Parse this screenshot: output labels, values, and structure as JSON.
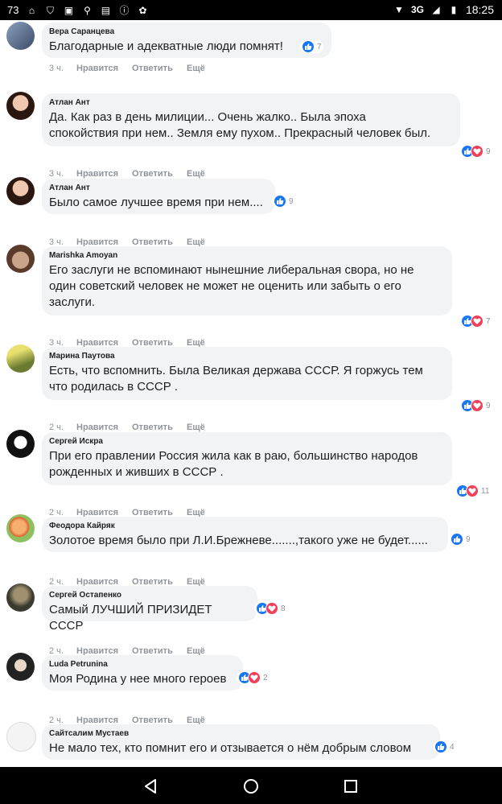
{
  "status_bar": {
    "left_text": "73",
    "network": "3G",
    "time": "18:25"
  },
  "actions": {
    "like": "Нравится",
    "reply": "Ответить",
    "more": "Ещё"
  },
  "comments": [
    {
      "author": "Вера Саранцева",
      "text": [
        "Благодарные и адекватные люди помнят!"
      ],
      "time": "3 ч.",
      "reactions": [
        "like"
      ],
      "count": "7"
    },
    {
      "author": "Атлан Ант",
      "text": [
        "Да. Как раз в день милиции... Очень жалко.. Была эпоха",
        "спокойствия при нем.. Земля ему пухом.. Прекрасный человек был."
      ],
      "time": "3 ч.",
      "reactions": [
        "like",
        "love"
      ],
      "count": "9"
    },
    {
      "author": "Атлан Ант",
      "text": [
        "Было самое лучшее время при нем...."
      ],
      "time": "3 ч.",
      "reactions": [
        "like"
      ],
      "count": "9"
    },
    {
      "author": "Marishka Amoyan",
      "text": [
        "Его заслуги не вспоминают нынешние либеральная свора, но не",
        "один советский человек не может не оценить или забыть о его",
        "заслуги."
      ],
      "time": "3 ч.",
      "reactions": [
        "like",
        "love"
      ],
      "count": "7"
    },
    {
      "author": "Марина Паутова",
      "text": [
        "Есть, что вспомнить. Была Великая держава СССР. Я горжусь тем",
        "что родилась в СССР ."
      ],
      "time": "2 ч.",
      "reactions": [
        "like",
        "love"
      ],
      "count": "9"
    },
    {
      "author": "Сергей Искра",
      "text": [
        "При его правлении Россия жила как в раю, большинство народов",
        "рожденных и живших в СССР ."
      ],
      "time": "2 ч.",
      "reactions": [
        "like",
        "love"
      ],
      "count": "11"
    },
    {
      "author": "Феодора Кайряк",
      "text": [
        "Золотое время было при Л.И.Брежневе.......,такого уже не будет......"
      ],
      "time": "2 ч.",
      "reactions": [
        "like"
      ],
      "count": "9"
    },
    {
      "author": "Сергей Остапенко",
      "text": [
        "Самый ЛУЧШИЙ ПРИЗИДЕТ СССР"
      ],
      "time": "2 ч.",
      "reactions": [
        "like",
        "love"
      ],
      "count": "8"
    },
    {
      "author": "Luda Petrunina",
      "text": [
        "Моя Родина у нее много героев"
      ],
      "time": "2 ч.",
      "reactions": [
        "like",
        "love"
      ],
      "count": "2"
    },
    {
      "author": "Сайтсалим Мустаев",
      "text": [
        "Не мало тех, кто помнит его и отзывается о нём добрым словом"
      ],
      "time": "",
      "reactions": [
        "like"
      ],
      "count": "4"
    }
  ]
}
